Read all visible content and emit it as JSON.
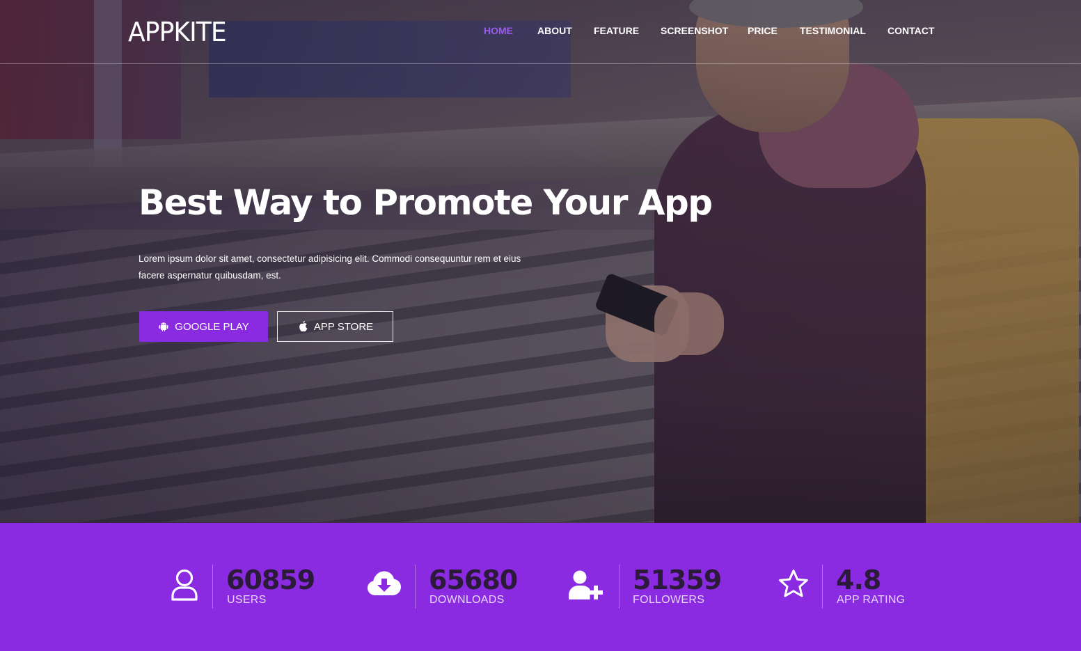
{
  "brand": {
    "logo": "APPKITE"
  },
  "nav": {
    "items": [
      {
        "label": "HOME",
        "active": true
      },
      {
        "label": "ABOUT",
        "active": false
      },
      {
        "label": "FEATURE",
        "active": false
      },
      {
        "label": "SCREENSHOT",
        "active": false
      },
      {
        "label": "PRICE",
        "active": false
      },
      {
        "label": "TESTIMONIAL",
        "active": false
      },
      {
        "label": "CONTACT",
        "active": false
      }
    ],
    "active_color": "#9b5bf0"
  },
  "hero": {
    "title": "Best Way to Promote Your App",
    "description": "Lorem ipsum dolor sit amet, consectetur adipisicing elit. Commodi consequuntur rem et eius facere aspernatur quibusdam, est.",
    "buttons": {
      "google_play": {
        "label": "GOOGLE PLAY",
        "icon": "android-icon"
      },
      "app_store": {
        "label": "APP STORE",
        "icon": "apple-icon"
      }
    }
  },
  "stats": {
    "accent_color": "#8a2be2",
    "items": [
      {
        "value": "60859",
        "label": "USERS",
        "icon": "user-icon"
      },
      {
        "value": "65680",
        "label": "DOWNLOADS",
        "icon": "cloud-download-icon"
      },
      {
        "value": "51359",
        "label": "FOLLOWERS",
        "icon": "user-plus-icon"
      },
      {
        "value": "4.8",
        "label": "APP RATING",
        "icon": "star-icon"
      }
    ]
  }
}
